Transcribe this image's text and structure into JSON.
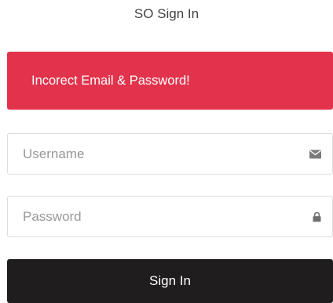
{
  "header": {
    "title": "SO Sign In"
  },
  "alert": {
    "message": "Incorect Email & Password!",
    "color": "#e2334d"
  },
  "form": {
    "username": {
      "placeholder": "Username",
      "value": "",
      "icon": "envelope-icon"
    },
    "password": {
      "placeholder": "Password",
      "value": "",
      "icon": "lock-icon"
    },
    "submit_label": "Sign In",
    "submit_color": "#1f1d1e"
  }
}
